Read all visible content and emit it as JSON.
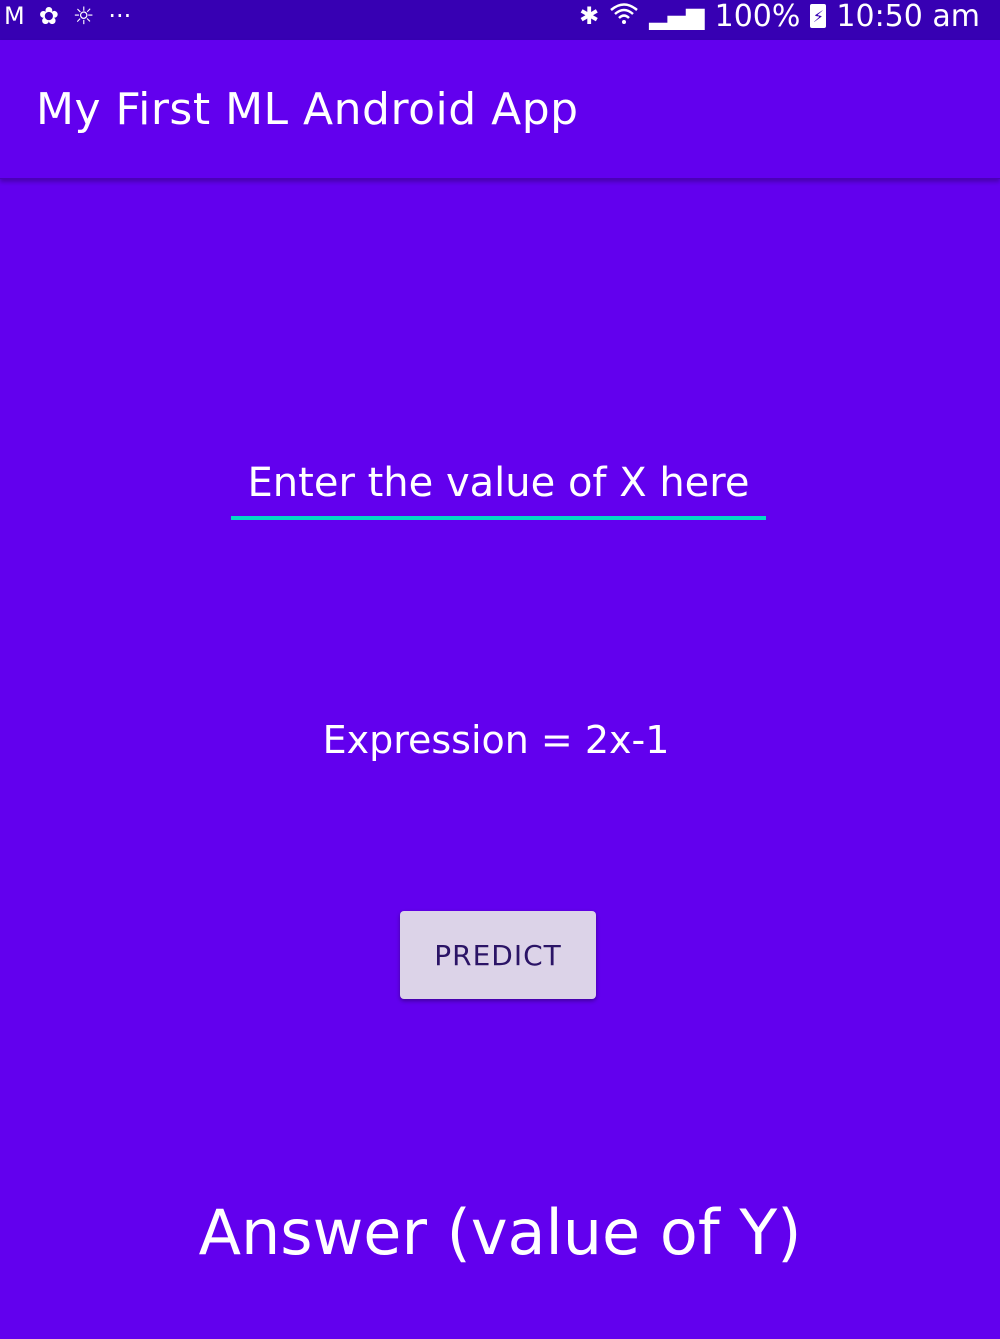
{
  "status_bar": {
    "left_icons": [
      "gmail-icon",
      "pinwheel-icon",
      "weather-icon",
      "more-notifications-icon"
    ],
    "left_glyphs": [
      "M",
      "✿",
      "☼",
      "···"
    ],
    "bluetooth_glyph": "✱",
    "signal_glyph": "▂▄▆",
    "battery_percent": "100%",
    "battery_glyph": "⚡",
    "time": "10:50 am"
  },
  "app_bar": {
    "title": "My First ML Android App"
  },
  "main": {
    "x_input": {
      "placeholder": "Enter the value of X here",
      "value": ""
    },
    "expression": "Expression = 2x-1",
    "predict_label": "PREDICT",
    "answer": "Answer (value of Y)"
  },
  "colors": {
    "background": "#6200EE",
    "status_bar": "#3700B3",
    "accent": "#03DAC5",
    "button_bg": "#DCD3E8"
  }
}
